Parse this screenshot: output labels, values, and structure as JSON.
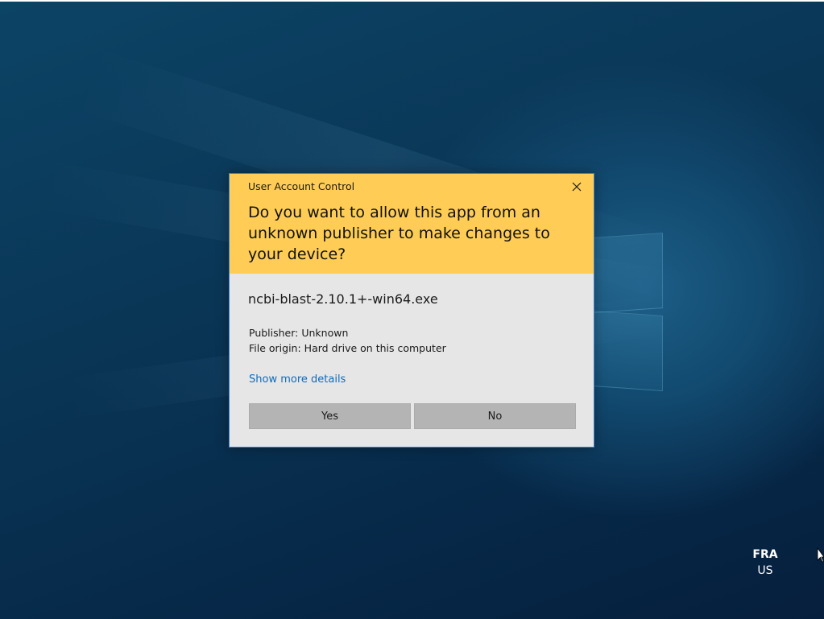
{
  "desktop": {
    "background_color": "#0a3656",
    "accent_color": "#ffcd55"
  },
  "dialog": {
    "title": "User Account Control",
    "question": "Do you want to allow this app from an unknown publisher to make changes to your device?",
    "program_name": "ncbi-blast-2.10.1+-win64.exe",
    "publisher": "Publisher: Unknown",
    "file_origin": "File origin: Hard drive on this computer",
    "details_link": "Show more details",
    "yes_label": "Yes",
    "no_label": "No",
    "close_icon": "close-icon"
  },
  "language_indicator": {
    "code": "FRA",
    "layout": "US"
  },
  "cursor": {
    "icon": "mouse-pointer-icon"
  }
}
